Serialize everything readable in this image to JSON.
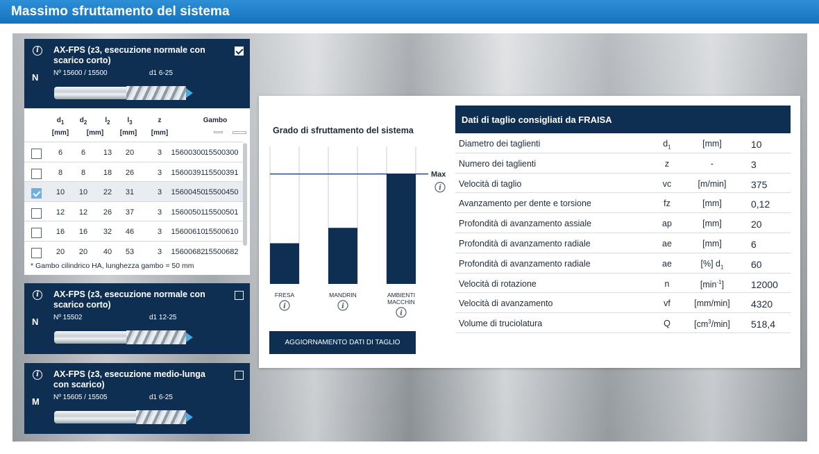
{
  "page_title": "Massimo sfruttamento del sistema",
  "tools": [
    {
      "material": "N",
      "name": "AX-FPS (z3, esecuzione normale con scarico corto)",
      "number": "Nº 15600 / 15500",
      "range": "d1 6-25",
      "checked": true
    },
    {
      "material": "N",
      "name": "AX-FPS (z3, esecuzione normale con scarico corto)",
      "number": "Nº 15502",
      "range": "d1 12-25",
      "checked": false
    },
    {
      "material": "M",
      "name": "AX-FPS (z3, esecuzione medio-lunga con scarico)",
      "number": "Nº 15605 / 15505",
      "range": "d1 6-25",
      "checked": false
    }
  ],
  "dimension_table": {
    "headers": {
      "d1": "d",
      "d1_sub": "1",
      "d2": "d",
      "d2_sub": "2",
      "l2": "l",
      "l2_sub": "2",
      "l3": "l",
      "l3_sub": "3",
      "z": "z",
      "unit": "[mm]",
      "gambo": "Gambo"
    },
    "rows": [
      {
        "d1": "6",
        "d2": "6",
        "l2": "13",
        "l3": "20",
        "z": "3",
        "code1": "15600300",
        "code2": "15500300",
        "checked": false
      },
      {
        "d1": "8",
        "d2": "8",
        "l2": "18",
        "l3": "26",
        "z": "3",
        "code1": "15600391",
        "code2": "15500391",
        "checked": false
      },
      {
        "d1": "10",
        "d2": "10",
        "l2": "22",
        "l3": "31",
        "z": "3",
        "code1": "15600450",
        "code2": "15500450",
        "checked": true
      },
      {
        "d1": "12",
        "d2": "12",
        "l2": "26",
        "l3": "37",
        "z": "3",
        "code1": "15600501",
        "code2": "15500501",
        "checked": false
      },
      {
        "d1": "16",
        "d2": "16",
        "l2": "32",
        "l3": "46",
        "z": "3",
        "code1": "15600610",
        "code2": "15500610",
        "checked": false
      },
      {
        "d1": "20",
        "d2": "20",
        "l2": "40",
        "l3": "53",
        "z": "3",
        "code1": "15600682",
        "code2": "15500682",
        "checked": false
      }
    ],
    "note": "* Gambo cilindrico HA, lunghezza gambo = 50 mm"
  },
  "chart_data": {
    "type": "bar",
    "title": "Grado di sfruttamento del sistema",
    "categories": [
      "FRESA",
      "MANDRINO",
      "AMBIENTI MACCHINA"
    ],
    "category_labels": [
      [
        "FRESA"
      ],
      [
        "MANDRIN"
      ],
      [
        "AMBIENTI",
        "MACCHIN"
      ]
    ],
    "values": [
      0.37,
      0.51,
      1.0
    ],
    "max_label": "Max",
    "ylim": [
      0,
      1.25
    ],
    "bar_color": "#0f2f52"
  },
  "update_button": "AGGIORNAMENTO DATI DI TAGLIO",
  "cutting_data": {
    "title": "Dati di taglio consigliati da FRAISA",
    "rows": [
      {
        "label": "Diametro dei taglienti",
        "symbol": "d",
        "symbol_sub": "1",
        "unit": "[mm]",
        "unit_sup": "",
        "unit_tail": "",
        "value": "10"
      },
      {
        "label": "Numero dei taglienti",
        "symbol": "z",
        "symbol_sub": "",
        "unit": "-",
        "unit_sup": "",
        "unit_tail": "",
        "value": "3"
      },
      {
        "label": "Velocità di taglio",
        "symbol": "vc",
        "symbol_sub": "",
        "unit": "[m/min]",
        "unit_sup": "",
        "unit_tail": "",
        "value": "375"
      },
      {
        "label": "Avanzamento per dente e torsione",
        "symbol": "fz",
        "symbol_sub": "",
        "unit": "[mm]",
        "unit_sup": "",
        "unit_tail": "",
        "value": "0,12"
      },
      {
        "label": "Profondità di avanzamento assiale",
        "symbol": "ap",
        "symbol_sub": "",
        "unit": "[mm]",
        "unit_sup": "",
        "unit_tail": "",
        "value": "20"
      },
      {
        "label": "Profondità di avanzamento radiale",
        "symbol": "ae",
        "symbol_sub": "",
        "unit": "[mm]",
        "unit_sup": "",
        "unit_tail": "",
        "value": "6"
      },
      {
        "label": "Profondità di avanzamento radiale",
        "symbol": "ae",
        "symbol_sub": "",
        "unit": "[%] d",
        "unit_sup": "",
        "unit_sub": "1",
        "unit_tail": "",
        "value": "60"
      },
      {
        "label": "Velocità di rotazione",
        "symbol": "n",
        "symbol_sub": "",
        "unit": "[min",
        "unit_sup": "-1",
        "unit_tail": "]",
        "value": "12000"
      },
      {
        "label": "Velocità di avanzamento",
        "symbol": "vf",
        "symbol_sub": "",
        "unit": "[mm/min]",
        "unit_sup": "",
        "unit_tail": "",
        "value": "4320"
      },
      {
        "label": "Volume di truciolatura",
        "symbol": "Q",
        "symbol_sub": "",
        "unit": "[cm",
        "unit_sup": "3",
        "unit_tail": "/min]",
        "value": "518,4"
      }
    ]
  },
  "colors": {
    "brand_blue": "#1572bd",
    "navy": "#0f2f52",
    "check_blue": "#6fb0e3"
  }
}
